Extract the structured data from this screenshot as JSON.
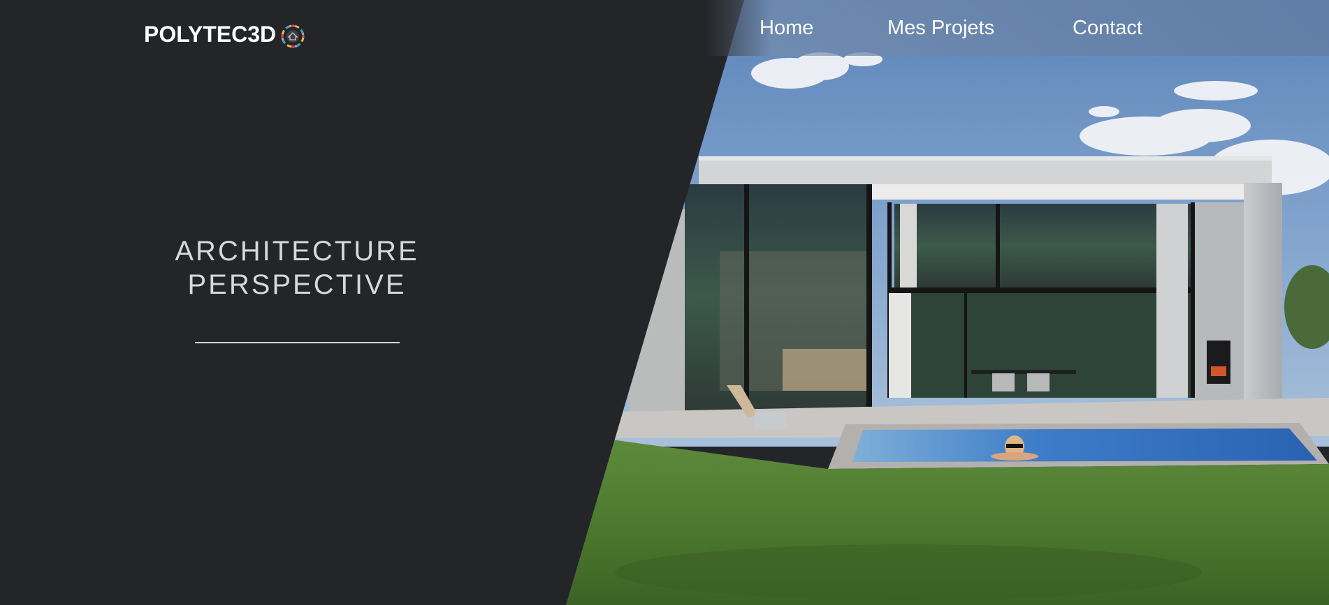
{
  "header": {
    "logo_text": "POLYTEC3D",
    "logo_icon": "circular-emblem-icon"
  },
  "nav": {
    "items": [
      {
        "label": "Home"
      },
      {
        "label": "Mes Projets"
      },
      {
        "label": "Contact"
      }
    ]
  },
  "hero": {
    "title_line1": "ARCHITECTURE",
    "title_line2": "PERSPECTIVE",
    "image_subject": "modern-house-with-pool-render"
  },
  "colors": {
    "dark_panel": "#242529",
    "header_tint": "#6e87aa",
    "title_text": "#d7d8da",
    "nav_text": "#ffffff"
  }
}
